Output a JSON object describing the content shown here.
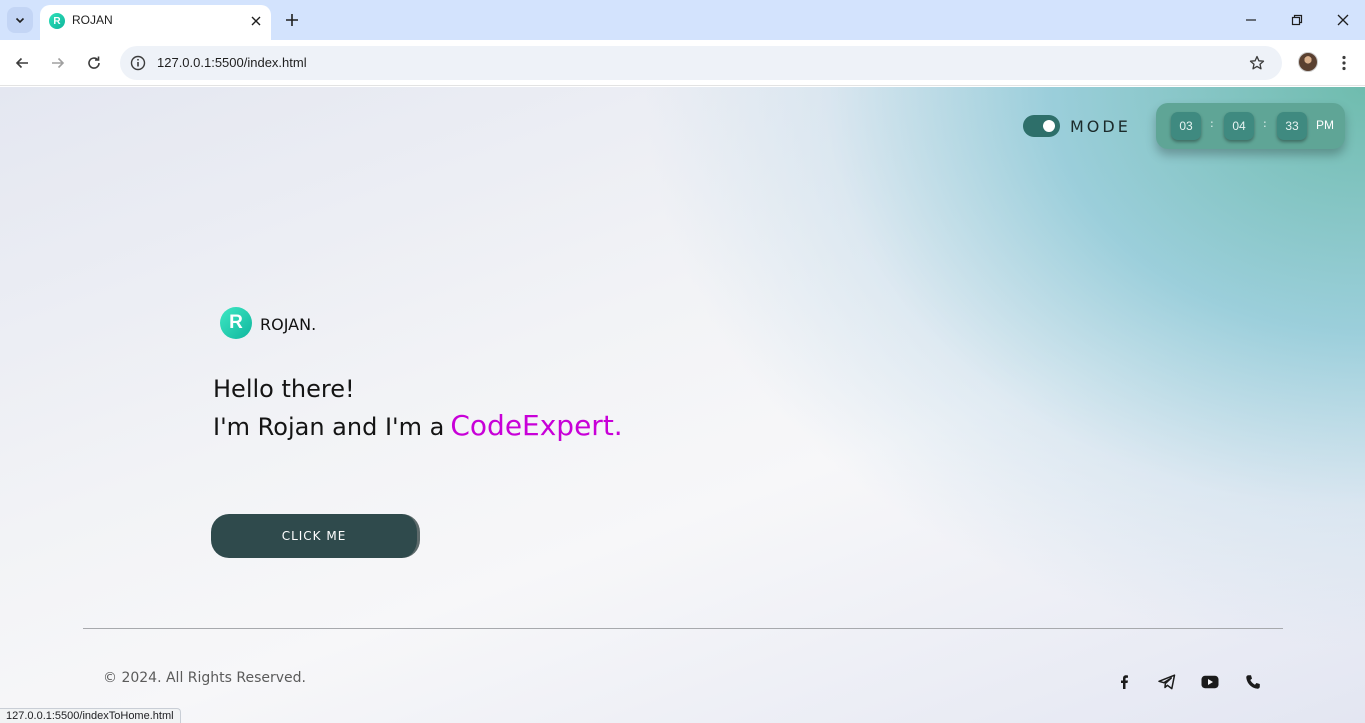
{
  "browser": {
    "tab_title": "ROJAN",
    "tab_favicon_letter": "R",
    "url": "127.0.0.1:5500/index.html",
    "status_url": "127.0.0.1:5500/indexToHome.html"
  },
  "header": {
    "mode_label": "MODE",
    "mode_on": true,
    "clock": {
      "hours": "03",
      "minutes": "04",
      "seconds": "33",
      "ampm": "PM",
      "separator": ":"
    }
  },
  "brand": {
    "logo_letter": "R",
    "name": "ROJAN."
  },
  "hero": {
    "line1": "Hello there!",
    "line2_prefix": "I'm Rojan and I'm a",
    "highlight": "CodeExpert.",
    "highlight_color": "#c800d8"
  },
  "cta": {
    "label": "CLICK ME"
  },
  "footer": {
    "copyright": "© 2024. All Rights Reserved.",
    "social": [
      "facebook-icon",
      "telegram-icon",
      "youtube-icon",
      "phone-icon"
    ]
  },
  "colors": {
    "accent": "#2f4a4c",
    "toggle": "#2e6f6a",
    "clock": "#5fa596"
  }
}
